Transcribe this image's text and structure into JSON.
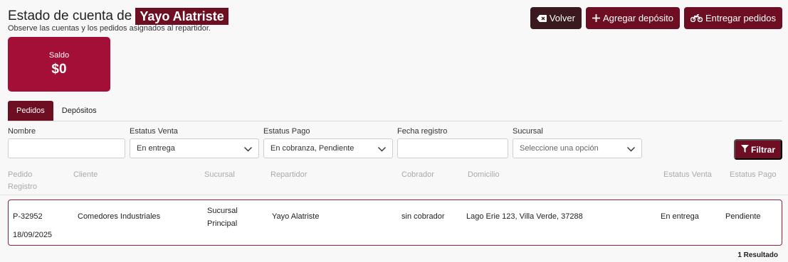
{
  "header": {
    "title": "Estado de cuenta de",
    "name": "Yayo Alatriste",
    "subtitle": "Observe las cuentas y los pedidos asignados al repartidor."
  },
  "actions": {
    "back": "Volver",
    "add_deposit": "Agregar depósito",
    "deliver_orders": "Entregar pedidos"
  },
  "balance": {
    "label": "Saldo",
    "value": "$0"
  },
  "tabs": [
    {
      "label": "Pedidos",
      "active": true
    },
    {
      "label": "Depósitos",
      "active": false
    }
  ],
  "filters": {
    "nombre": {
      "label": "Nombre",
      "value": ""
    },
    "estatus_venta": {
      "label": "Estatus Venta",
      "value": "En entrega"
    },
    "estatus_pago": {
      "label": "Estatus Pago",
      "value": "En cobranza, Pendiente"
    },
    "fecha_registro": {
      "label": "Fecha registro",
      "value": ""
    },
    "sucursal": {
      "label": "Sucursal",
      "placeholder": "Seleccione una opción"
    },
    "filter_button": "Filtrar"
  },
  "table": {
    "headers": {
      "pedido": "Pedido",
      "registro": "Registro",
      "cliente": "Cliente",
      "sucursal": "Sucursal",
      "repartidor": "Repartidor",
      "cobrador": "Cobrador",
      "domicilio": "Domicilio",
      "estatus_venta": "Estatus Venta",
      "estatus_pago": "Estatus Pago"
    },
    "rows": [
      {
        "pedido": "P-32952",
        "registro": "18/09/2025",
        "cliente": "Comedores Industriales",
        "sucursal_1": "Sucursal",
        "sucursal_2": "Principal",
        "repartidor": "Yayo Alatriste",
        "cobrador": "sin cobrador",
        "domicilio": "Lago Erie 123, Villa Verde, 37288",
        "estatus_venta": "En entrega",
        "estatus_pago": "Pendiente"
      }
    ]
  },
  "result_count": "1 Resultado",
  "colors": {
    "primary": "#6e0e22",
    "card": "#a30f36",
    "dark_button": "#3a1a1e"
  }
}
